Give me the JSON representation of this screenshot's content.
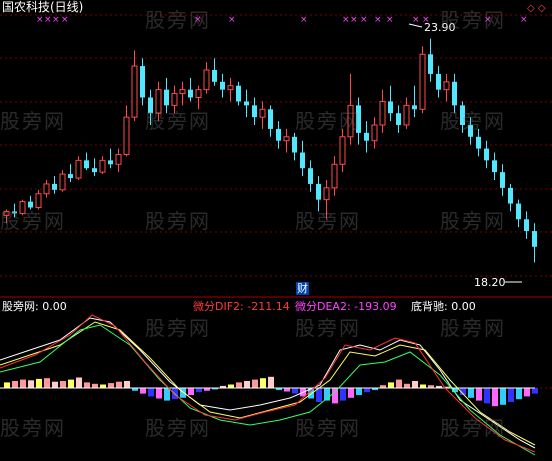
{
  "header": {
    "stock_title": "国农科技(日线)"
  },
  "price_panel": {
    "high_label": "23.90",
    "low_label": "18.20",
    "event_badge": "财",
    "colors": {
      "up": "#ff4a4a",
      "down": "#55e6ff",
      "grid": "#7a0000",
      "marker": "#ff44ff"
    }
  },
  "indicator_panel": {
    "name_value": "股旁网: 0.00",
    "dif_text": "微分DIF2: -211.14",
    "dea_text": "微分DEA2: -193.09",
    "divergence_text": "底背驰: 0.00",
    "colors": {
      "dif": "#ff3a3a",
      "dea": "#ff44ff",
      "line_a": "#ffffff",
      "line_b": "#ffff66",
      "line_c": "#33ff66",
      "line_d": "#ff3333"
    }
  },
  "watermark": "股旁网",
  "chart_data": [
    {
      "type": "candlestick",
      "title": "国农科技(日线)",
      "ylim": [
        17.5,
        24.5
      ],
      "annotations": [
        "23.90",
        "18.20"
      ],
      "candles": [
        [
          19.4,
          19.55,
          19.2,
          19.5
        ],
        [
          19.5,
          19.7,
          19.35,
          19.45
        ],
        [
          19.45,
          19.8,
          19.4,
          19.75
        ],
        [
          19.75,
          19.9,
          19.55,
          19.6
        ],
        [
          19.6,
          20.05,
          19.55,
          19.95
        ],
        [
          19.95,
          20.3,
          19.85,
          20.2
        ],
        [
          20.2,
          20.4,
          19.95,
          20.05
        ],
        [
          20.05,
          20.55,
          20.0,
          20.45
        ],
        [
          20.45,
          20.7,
          20.25,
          20.35
        ],
        [
          20.35,
          20.9,
          20.3,
          20.8
        ],
        [
          20.8,
          21.0,
          20.55,
          20.6
        ],
        [
          20.6,
          20.85,
          20.4,
          20.5
        ],
        [
          20.5,
          20.9,
          20.45,
          20.8
        ],
        [
          20.8,
          21.1,
          20.6,
          20.7
        ],
        [
          20.7,
          21.1,
          20.5,
          20.95
        ],
        [
          20.95,
          22.2,
          20.9,
          21.9
        ],
        [
          21.9,
          23.6,
          21.8,
          23.2
        ],
        [
          23.2,
          23.4,
          22.2,
          22.4
        ],
        [
          22.4,
          22.6,
          21.7,
          22.0
        ],
        [
          22.0,
          22.8,
          21.8,
          22.6
        ],
        [
          22.6,
          22.9,
          22.0,
          22.2
        ],
        [
          22.2,
          22.7,
          22.0,
          22.5
        ],
        [
          22.5,
          22.8,
          22.2,
          22.6
        ],
        [
          22.6,
          22.9,
          22.3,
          22.4
        ],
        [
          22.4,
          22.7,
          22.1,
          22.6
        ],
        [
          22.6,
          23.3,
          22.5,
          23.1
        ],
        [
          23.1,
          23.4,
          22.7,
          22.8
        ],
        [
          22.8,
          23.0,
          22.4,
          22.6
        ],
        [
          22.6,
          22.9,
          22.3,
          22.7
        ],
        [
          22.7,
          22.8,
          22.2,
          22.3
        ],
        [
          22.3,
          22.6,
          21.9,
          22.2
        ],
        [
          22.2,
          22.4,
          21.7,
          21.9
        ],
        [
          21.9,
          22.3,
          21.6,
          22.1
        ],
        [
          22.1,
          22.2,
          21.4,
          21.6
        ],
        [
          21.6,
          21.8,
          21.1,
          21.3
        ],
        [
          21.3,
          21.6,
          21.0,
          21.4
        ],
        [
          21.4,
          21.5,
          20.8,
          21.0
        ],
        [
          21.0,
          21.3,
          20.4,
          20.6
        ],
        [
          20.6,
          20.8,
          20.0,
          20.2
        ],
        [
          20.2,
          20.4,
          19.5,
          19.8
        ],
        [
          19.8,
          20.3,
          19.3,
          20.1
        ],
        [
          20.1,
          20.9,
          19.9,
          20.7
        ],
        [
          20.7,
          21.6,
          20.5,
          21.4
        ],
        [
          21.4,
          23.0,
          21.2,
          22.2
        ],
        [
          22.2,
          22.4,
          21.2,
          21.5
        ],
        [
          21.5,
          21.8,
          21.0,
          21.3
        ],
        [
          21.3,
          21.9,
          21.1,
          21.7
        ],
        [
          21.7,
          22.6,
          21.5,
          22.3
        ],
        [
          22.3,
          22.7,
          21.8,
          22.0
        ],
        [
          22.0,
          22.2,
          21.5,
          21.7
        ],
        [
          21.7,
          22.4,
          21.6,
          22.2
        ],
        [
          22.2,
          22.7,
          21.9,
          22.1
        ],
        [
          22.1,
          23.7,
          22.0,
          23.5
        ],
        [
          23.5,
          23.9,
          22.8,
          23.0
        ],
        [
          23.0,
          23.2,
          22.4,
          22.6
        ],
        [
          22.6,
          23.0,
          22.3,
          22.8
        ],
        [
          22.8,
          23.0,
          22.0,
          22.2
        ],
        [
          22.2,
          22.3,
          21.5,
          21.7
        ],
        [
          21.7,
          21.9,
          21.2,
          21.4
        ],
        [
          21.4,
          21.6,
          20.9,
          21.1
        ],
        [
          21.1,
          21.3,
          20.6,
          20.8
        ],
        [
          20.8,
          21.0,
          20.3,
          20.5
        ],
        [
          20.5,
          20.7,
          19.9,
          20.1
        ],
        [
          20.1,
          20.2,
          19.5,
          19.7
        ],
        [
          19.7,
          19.8,
          19.1,
          19.3
        ],
        [
          19.3,
          19.5,
          18.8,
          19.0
        ],
        [
          19.0,
          19.2,
          18.2,
          18.6
        ]
      ]
    },
    {
      "type": "bar",
      "title": "",
      "series": [
        {
          "name": "微分DIF2",
          "last_value": -211.14
        },
        {
          "name": "微分DEA2",
          "last_value": -193.09
        },
        {
          "name": "底背驰",
          "last_value": 0.0
        }
      ],
      "histogram": [
        8,
        10,
        12,
        11,
        13,
        14,
        9,
        10,
        12,
        15,
        8,
        6,
        5,
        7,
        9,
        10,
        -4,
        -8,
        -12,
        -15,
        -18,
        -16,
        -14,
        -10,
        -6,
        -4,
        -2,
        3,
        5,
        8,
        10,
        12,
        14,
        16,
        -3,
        -5,
        -8,
        -12,
        -15,
        -20,
        -18,
        -22,
        -18,
        -14,
        -10,
        -6,
        -3,
        4,
        8,
        12,
        6,
        10,
        5,
        4,
        3,
        2,
        -6,
        -10,
        -14,
        -18,
        -22,
        -26,
        -24,
        -20,
        -16,
        -12,
        -8
      ],
      "ylim": [
        -70,
        70
      ]
    }
  ]
}
